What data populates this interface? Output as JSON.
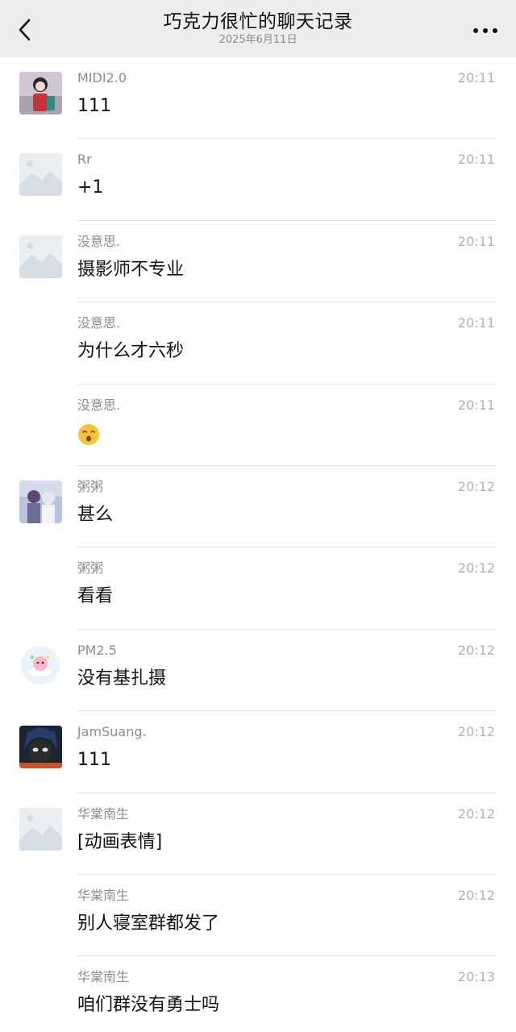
{
  "header": {
    "title": "巧克力很忙的聊天记录",
    "date": "2025年6月11日"
  },
  "messages": [
    {
      "sender": "MIDI2.0",
      "time": "20:11",
      "text": "111",
      "avatar": "anime-girl-avatar"
    },
    {
      "sender": "Rr",
      "time": "20:11",
      "text": "+1",
      "avatar": "placeholder-avatar"
    },
    {
      "sender": "没意思.",
      "time": "20:11",
      "text": "摄影师不专业",
      "avatar": "placeholder-avatar"
    },
    {
      "sender": "没意思.",
      "time": "20:11",
      "text": "为什么才六秒",
      "avatar": ""
    },
    {
      "sender": "没意思.",
      "time": "20:11",
      "text": "",
      "emoji": "sleeping-face-emoji",
      "avatar": ""
    },
    {
      "sender": "粥粥",
      "time": "20:12",
      "text": "甚么",
      "avatar": "anime-couple-avatar"
    },
    {
      "sender": "粥粥",
      "time": "20:12",
      "text": "看看",
      "avatar": ""
    },
    {
      "sender": "PM2.5",
      "time": "20:12",
      "text": "没有基扎摄",
      "avatar": "kirby-cloud-avatar"
    },
    {
      "sender": "JamSuang.",
      "time": "20:12",
      "text": "111",
      "avatar": "anime-boy-avatar"
    },
    {
      "sender": "华棠南生",
      "time": "20:12",
      "text": "[动画表情]",
      "avatar": "placeholder-avatar"
    },
    {
      "sender": "华棠南生",
      "time": "20:12",
      "text": "别人寝室群都发了",
      "avatar": ""
    },
    {
      "sender": "华棠南生",
      "time": "20:13",
      "text": "咱们群没有勇士吗",
      "avatar": ""
    }
  ],
  "colors": {
    "header_bg": "#ededed",
    "divider": "#e3e3e3",
    "sender_text": "#8c8c8c",
    "time_text": "#b0b0b0"
  }
}
